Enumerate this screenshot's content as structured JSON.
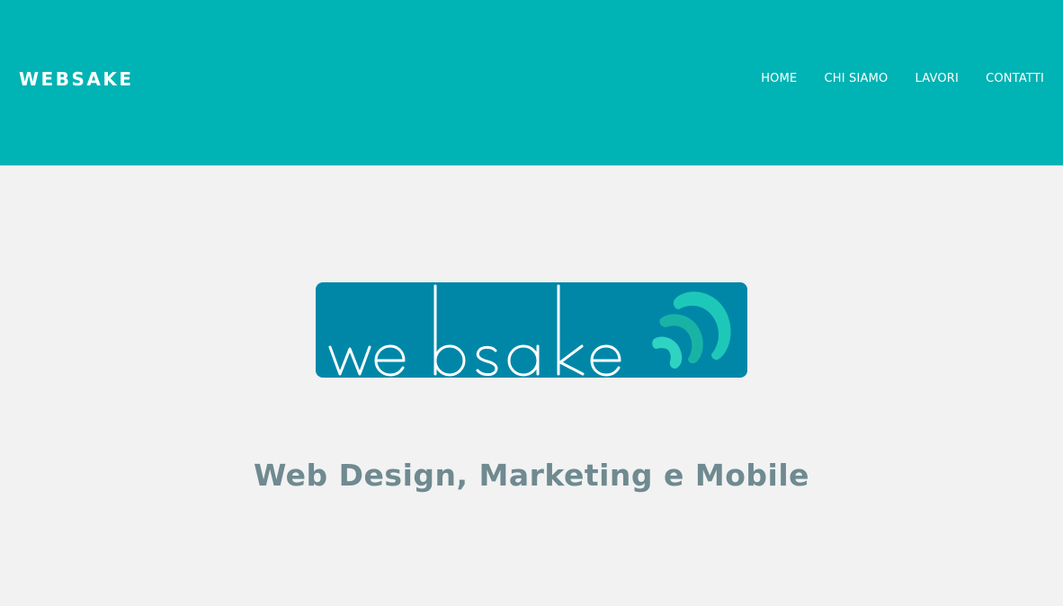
{
  "header": {
    "brand": "WEBSAKE",
    "nav": [
      {
        "label": "HOME"
      },
      {
        "label": "CHI SIAMO"
      },
      {
        "label": "LAVORI"
      },
      {
        "label": "CONTATTI"
      }
    ]
  },
  "hero": {
    "logo_wordmark": "websake",
    "tagline": "Web Design, Marketing e Mobile"
  },
  "colors": {
    "header_bg": "#00b3b4",
    "page_bg": "#f2f2f2",
    "logo_bg": "#0087a8",
    "logo_accent": "#1ec8b8",
    "tagline_text": "#6f8a90"
  }
}
